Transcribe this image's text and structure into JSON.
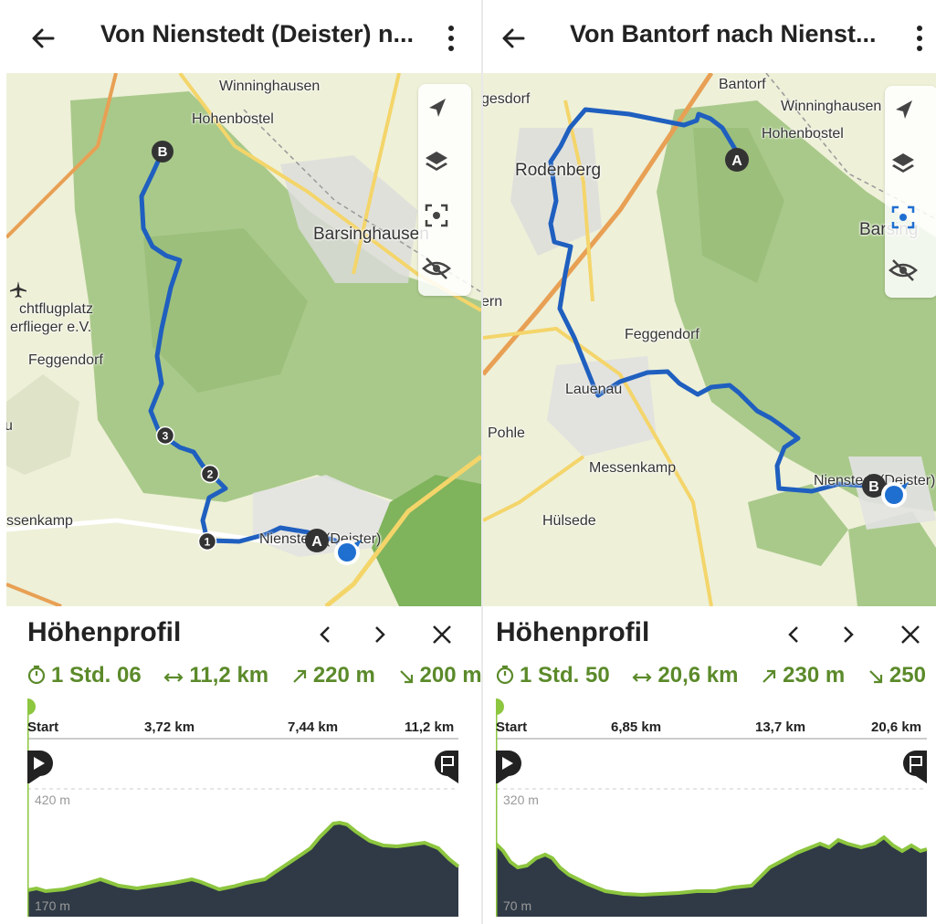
{
  "left": {
    "title": "Von Nienstedt (Deister) n...",
    "map_labels": {
      "winninghausen": "Winninghausen",
      "hohenbostel": "Hohenbostel",
      "barsinghausen": "Barsinghausen",
      "flugplatz1": "chtflugplatz",
      "flugplatz2": "erflieger e.V.",
      "feggendorf": "Feggendorf",
      "messenkamp": "ssenkamp",
      "nienstedt": "Nienstedt (Deister)",
      "u": "u"
    },
    "markers": {
      "start": "A",
      "end": "B",
      "w1": "1",
      "w2": "2",
      "w3": "3"
    },
    "profile_title": "Höhenprofil",
    "stats": {
      "duration": "1 Std. 06",
      "distance": "11,2 km",
      "ascent": "220 m",
      "descent": "200 m"
    },
    "ticks": [
      "Start",
      "3,72 km",
      "7,44 km",
      "11,2 km"
    ],
    "elev_high": "420 m",
    "elev_low": "170 m"
  },
  "right": {
    "title": "Von Bantorf nach Nienst...",
    "map_labels": {
      "gesdorf": "gesdorf",
      "bantorf": "Bantorf",
      "winninghausen": "Winninghausen",
      "hohenbostel": "Hohenbostel",
      "rodenberg": "Rodenberg",
      "barsing": "Barsing",
      "ern": "ern",
      "feggendorf": "Feggendorf",
      "lauenau": "Lauenau",
      "pohle": "Pohle",
      "messenkamp": "Messenkamp",
      "nienstedt": "Nienstedt (Deister)",
      "hulsede": "Hülsede"
    },
    "markers": {
      "start": "A",
      "end": "B"
    },
    "profile_title": "Höhenprofil",
    "stats": {
      "duration": "1 Std. 50",
      "distance": "20,6 km",
      "ascent": "230 m",
      "descent": "250"
    },
    "ticks": [
      "Start",
      "6,85 km",
      "13,7 km",
      "20,6 km"
    ],
    "elev_high": "320 m",
    "elev_low": "70 m"
  },
  "colors": {
    "route": "#1f5fbf",
    "accent": "#5b8a2a",
    "forest": "#a9c98a",
    "profile_fill": "#2f3a46"
  }
}
